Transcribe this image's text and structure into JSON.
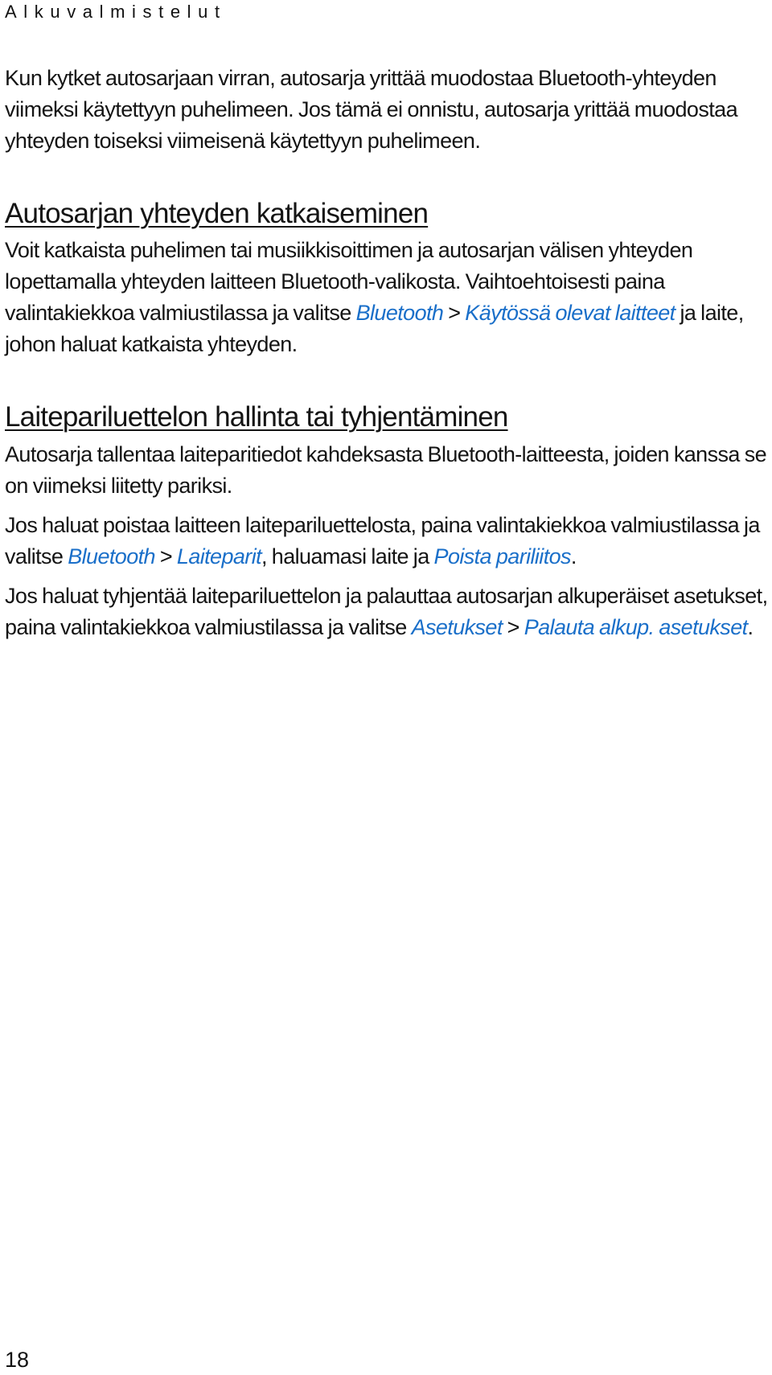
{
  "header": {
    "title": "Alkuvalmistelut"
  },
  "intro": {
    "text": "Kun kytket autosarjaan virran, autosarja yrittää muodostaa Bluetooth-yhteyden viimeksi käytettyyn puhelimeen. Jos tämä ei onnistu, autosarja yrittää muodostaa yhteyden toiseksi viimeisenä käytettyyn puhelimeen."
  },
  "section1": {
    "heading": "Autosarjan yhteyden katkaiseminen",
    "p1_text": "Voit katkaista puhelimen tai musiikkisoittimen ja autosarjan välisen yhteyden lopettamalla yhteyden laitteen Bluetooth-valikosta. Vaihtoehtoisesti paina valintakiekkoa valmiustilassa ja valitse ",
    "p1_link1": "Bluetooth",
    "p1_sep1": " > ",
    "p1_link2": "Käytössä olevat laitteet",
    "p1_tail": " ja laite, johon haluat katkaista yhteyden."
  },
  "section2": {
    "heading": "Laitepariluettelon hallinta tai tyhjentäminen",
    "p1_text": "Autosarja tallentaa laiteparitiedot kahdeksasta Bluetooth-laitteesta, joiden kanssa se on viimeksi liitetty pariksi.",
    "p2_text": "Jos haluat poistaa laitteen laitepariluettelosta, paina valintakiekkoa valmiustilassa ja valitse ",
    "p2_link1": "Bluetooth",
    "p2_sep1": " > ",
    "p2_link2": "Laiteparit",
    "p2_mid": ", haluamasi laite ja ",
    "p2_link3": "Poista pariliitos",
    "p2_tail": ".",
    "p3_text": "Jos haluat tyhjentää laitepariluettelon ja palauttaa autosarjan alkuperäiset asetukset, paina valintakiekkoa valmiustilassa ja valitse ",
    "p3_link1": "Asetukset",
    "p3_sep1": " > ",
    "p3_link2": "Palauta alkup. asetukset",
    "p3_tail": "."
  },
  "footer": {
    "page_number": "18"
  },
  "colors": {
    "link": "#1a6fc9",
    "text": "#141414"
  }
}
